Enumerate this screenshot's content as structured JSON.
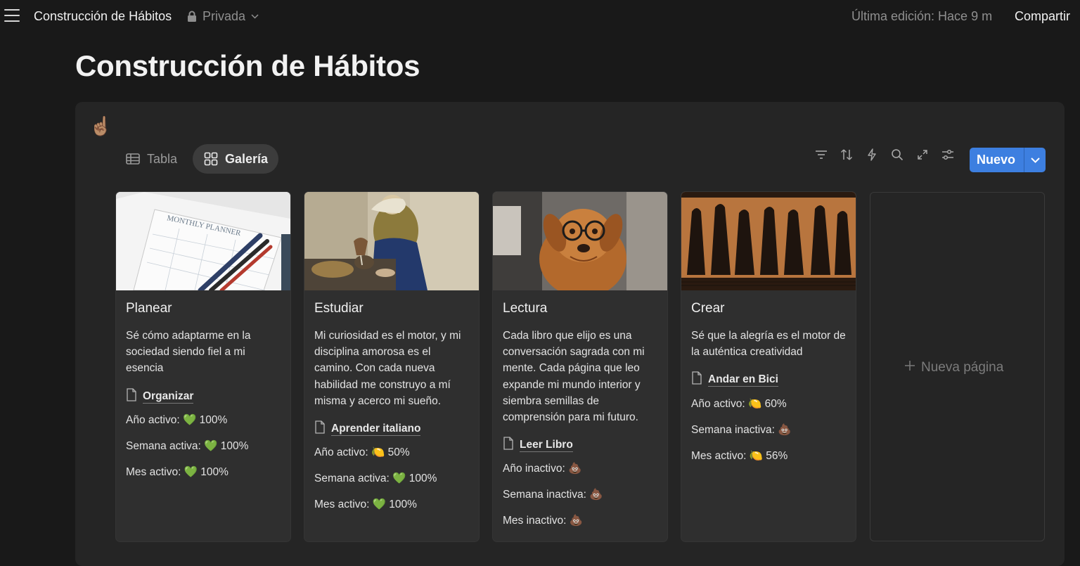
{
  "header": {
    "breadcrumb_title": "Construcción de Hábitos",
    "privacy_label": "Privada",
    "last_edited": "Última edición: Hace 9 m",
    "share_label": "Compartir"
  },
  "page": {
    "title": "Construcción de Hábitos",
    "callout_icon": "☝🏽"
  },
  "views": {
    "tabs": [
      {
        "label": "Tabla",
        "icon": "table-icon",
        "active": false
      },
      {
        "label": "Galería",
        "icon": "gallery-icon",
        "active": true
      }
    ],
    "new_label": "Nuevo"
  },
  "cards": [
    {
      "title": "Planear",
      "description": "Sé cómo adaptarme en la sociedad siendo fiel a mi esencia",
      "relation": "Organizar",
      "props": [
        "Año activo: 💚 100%",
        "Semana activa: 💚 100%",
        "Mes activo: 💚 100%"
      ],
      "cover_text": "MONTHLY PLANNER"
    },
    {
      "title": "Estudiar",
      "description": "Mi curiosidad es el motor, y mi disciplina amorosa es el camino. Con cada nueva habilidad me construyo a mí misma y acerco mi sueño.",
      "relation": "Aprender italiano",
      "props": [
        "Año activo: 🍋 50%",
        "Semana activa: 💚 100%",
        "Mes activo: 💚 100%"
      ]
    },
    {
      "title": "Lectura",
      "description": "Cada libro que elijo es una conversación sagrada con mi mente. Cada página que leo expande mi mundo interior y siembra semillas de comprensión para mi futuro.",
      "relation": "Leer Libro",
      "props": [
        "Año inactivo: 💩",
        "Semana inactiva: 💩",
        "Mes inactivo: 💩"
      ]
    },
    {
      "title": "Crear",
      "description": "Sé que la alegría es el motor de la auténtica creatividad",
      "relation": "Andar en Bici",
      "props": [
        "Año activo: 🍋 60%",
        "Semana inactiva: 💩",
        "Mes activo: 🍋 56%"
      ]
    }
  ],
  "new_page_label": "Nueva página",
  "colors": {
    "background": "#191919",
    "panel": "#252525",
    "card": "#2f2f2f",
    "accent": "#3d7fe0"
  }
}
